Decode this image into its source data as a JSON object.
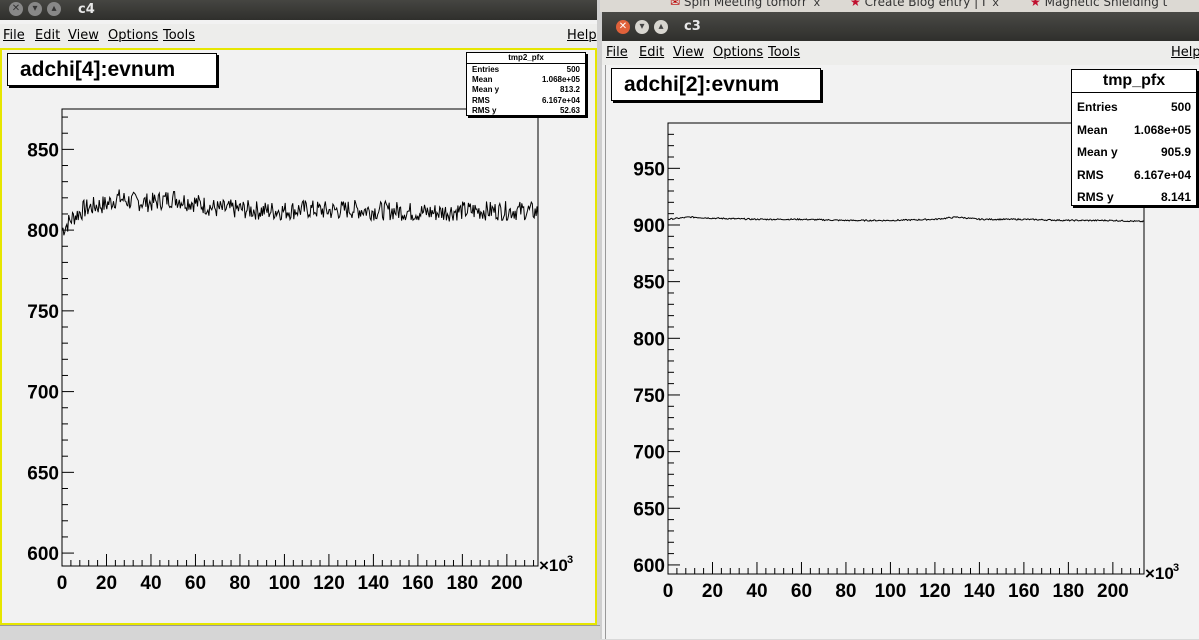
{
  "browser_tabs": [
    {
      "label": "Spin Meeting tomorr",
      "close": "x"
    },
    {
      "label": "Create Blog entry | I",
      "close": "x"
    },
    {
      "label": "Magnetic Shielding t",
      "close": ""
    }
  ],
  "windows": [
    {
      "title": "c4",
      "menus": [
        "File",
        "Edit",
        "View",
        "Options",
        "Tools",
        "Help"
      ],
      "plot_title": "adchi[4]:evnum",
      "stats": {
        "name": "tmp2_pfx",
        "rows": [
          {
            "label": "Entries",
            "value": "500"
          },
          {
            "label": "Mean",
            "value": "1.068e+05"
          },
          {
            "label": "Mean y",
            "value": "813.2"
          },
          {
            "label": "RMS",
            "value": "6.167e+04"
          },
          {
            "label": "RMS y",
            "value": "52.63"
          }
        ]
      },
      "x_multiplier": "×10",
      "x_multiplier_exp": "3"
    },
    {
      "title": "c3",
      "menus": [
        "File",
        "Edit",
        "View",
        "Options",
        "Tools",
        "Help"
      ],
      "plot_title": "adchi[2]:evnum",
      "stats": {
        "name": "tmp_pfx",
        "rows": [
          {
            "label": "Entries",
            "value": "500"
          },
          {
            "label": "Mean",
            "value": "1.068e+05"
          },
          {
            "label": "Mean y",
            "value": "905.9"
          },
          {
            "label": "RMS",
            "value": "6.167e+04"
          },
          {
            "label": "RMS y",
            "value": "8.141"
          }
        ]
      },
      "x_multiplier": "×10",
      "x_multiplier_exp": "3"
    }
  ],
  "chart_data": [
    {
      "type": "line",
      "title": "adchi[4]:evnum",
      "xlabel": "",
      "ylabel": "",
      "xlim": [
        0,
        214
      ],
      "ylim": [
        592,
        875
      ],
      "x_ticks": [
        0,
        20,
        40,
        60,
        80,
        100,
        120,
        140,
        160,
        180,
        200
      ],
      "y_ticks": [
        600,
        650,
        700,
        750,
        800,
        850
      ],
      "grid": false,
      "series": [
        {
          "x": [
            0,
            5,
            10,
            15,
            20,
            25,
            30,
            40,
            50,
            55,
            60,
            70,
            80,
            90,
            100,
            110,
            120,
            130,
            140,
            150,
            160,
            170,
            180,
            190,
            200,
            210,
            214
          ],
          "y": [
            800,
            808,
            813,
            815,
            816,
            820,
            818,
            817,
            820,
            818,
            817,
            813,
            813,
            812,
            812,
            813,
            812,
            813,
            812,
            812,
            811,
            811,
            812,
            812,
            812,
            812,
            811
          ],
          "jitter": 6
        }
      ]
    },
    {
      "type": "line",
      "title": "adchi[2]:evnum",
      "xlabel": "",
      "ylabel": "",
      "xlim": [
        0,
        214
      ],
      "ylim": [
        592,
        990
      ],
      "x_ticks": [
        0,
        20,
        40,
        60,
        80,
        100,
        120,
        140,
        160,
        180,
        200
      ],
      "y_ticks": [
        600,
        650,
        700,
        750,
        800,
        850,
        900,
        950
      ],
      "grid": false,
      "series": [
        {
          "x": [
            0,
            10,
            20,
            40,
            60,
            80,
            100,
            120,
            130,
            140,
            160,
            180,
            200,
            214
          ],
          "y": [
            905,
            907,
            906,
            905,
            905,
            904,
            904,
            905,
            907,
            905,
            905,
            904,
            904,
            903
          ],
          "jitter": 0.6
        }
      ]
    }
  ]
}
